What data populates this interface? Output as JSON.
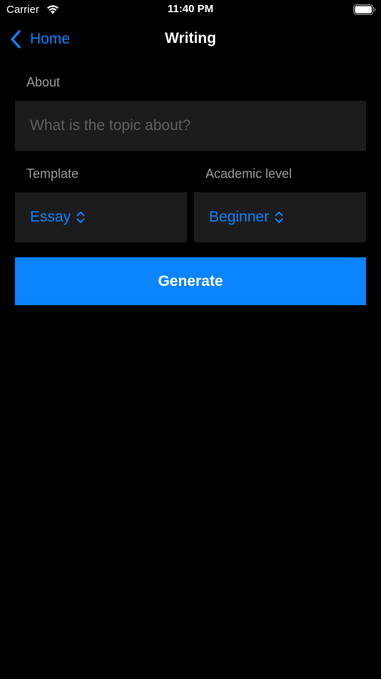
{
  "status_bar": {
    "carrier": "Carrier",
    "time": "11:40 PM",
    "wifi_icon": "wifi-icon",
    "battery_icon": "battery-icon"
  },
  "nav": {
    "back_label": "Home",
    "back_icon": "chevron-left-icon",
    "title": "Writing"
  },
  "form": {
    "about_label": "About",
    "about_placeholder": "What is the topic about?",
    "about_value": "",
    "template_label": "Template",
    "template_value": "Essay",
    "academic_label": "Academic level",
    "academic_value": "Beginner",
    "picker_icon": "chevron-up-down-icon",
    "generate_label": "Generate"
  },
  "colors": {
    "accent": "#0a84ff",
    "background": "#000000",
    "field_background": "#1c1c1e",
    "label": "#98989f",
    "placeholder": "#5f5f63"
  }
}
